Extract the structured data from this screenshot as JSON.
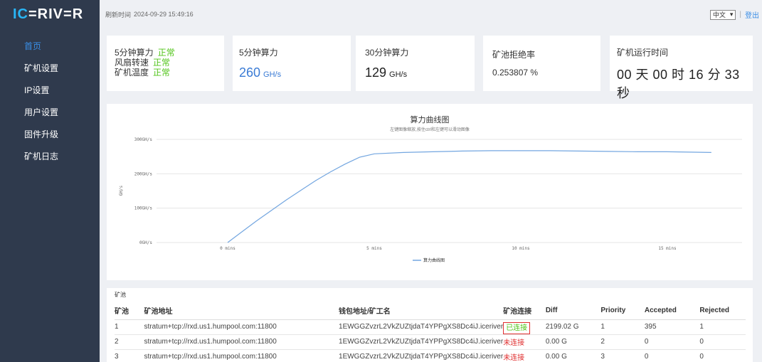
{
  "logo": {
    "part1": "IC",
    "part2": "=RIV=R"
  },
  "sidebar": {
    "items": [
      "首页",
      "矿机设置",
      "IP设置",
      "用户设置",
      "固件升级",
      "矿机日志"
    ]
  },
  "topbar": {
    "refresh_label": "刷新时间",
    "refresh_time": "2024-09-29 15:49:16",
    "language": "中文",
    "logout": "登出"
  },
  "status": {
    "rows": [
      {
        "label": "5分钟算力",
        "value": "正常"
      },
      {
        "label": "风扇转速",
        "value": "正常"
      },
      {
        "label": "矿机温度",
        "value": "正常"
      }
    ]
  },
  "hash5": {
    "title": "5分钟算力",
    "value": "260",
    "unit": "GH/s"
  },
  "hash30": {
    "title": "30分钟算力",
    "value": "129",
    "unit": "GH/s"
  },
  "reject": {
    "title": "矿池拒绝率",
    "value": "0.253807 %"
  },
  "runtime": {
    "title": "矿机运行时间",
    "value": "00 天 00 时 16 分 33 秒"
  },
  "chart_data": {
    "type": "line",
    "title": "算力曲线图",
    "subtitle": "左键图像缩放,按住ctrl和左键可以滑动图像",
    "ylabel": "GH/s",
    "y_ticks": [
      "300GH/s",
      "200GH/s",
      "100GH/s",
      "0GH/s"
    ],
    "x_ticks": [
      "0 mins",
      "5 mins",
      "10 mins",
      "15 mins"
    ],
    "legend": "算力曲线图",
    "ylim": [
      0,
      300
    ],
    "xlim": [
      0,
      16.5
    ],
    "series": [
      {
        "name": "算力曲线图",
        "x": [
          0,
          0.5,
          1,
          1.5,
          2,
          2.5,
          3,
          3.5,
          4,
          4.5,
          5,
          6,
          7,
          8,
          9,
          10,
          11,
          12,
          13,
          14,
          15,
          16.5
        ],
        "values": [
          0,
          32,
          64,
          94,
          124,
          152,
          180,
          205,
          228,
          248,
          258,
          262,
          264,
          266,
          267,
          267,
          267,
          266,
          265,
          264,
          264,
          262
        ]
      }
    ],
    "color": "#73a6e0"
  },
  "pool": {
    "title": "矿池",
    "headers": [
      "矿池",
      "矿池地址",
      "钱包地址/矿工名",
      "矿池连接",
      "Diff",
      "Priority",
      "Accepted",
      "Rejected"
    ],
    "rows": [
      [
        "1",
        "stratum+tcp://rxd.us1.humpool.com:11800",
        "1EWGGZvzrL2VkZUZtjdaT4YPPgXS8Dc4iJ.iceriver",
        "已连接",
        "2199.02 G",
        "1",
        "395",
        "1"
      ],
      [
        "2",
        "stratum+tcp://rxd.us1.humpool.com:11800",
        "1EWGGZvzrL2VkZUZtjdaT4YPPgXS8Dc4iJ.iceriver",
        "未连接",
        "0.00 G",
        "2",
        "0",
        "0"
      ],
      [
        "3",
        "stratum+tcp://rxd.us1.humpool.com:11800",
        "1EWGGZvzrL2VkZUZtjdaT4YPPgXS8Dc4iJ.iceriver",
        "未连接",
        "0.00 G",
        "3",
        "0",
        "0"
      ]
    ]
  },
  "colors": {
    "sidebar": "#2f3a4d",
    "accent": "#3a8ee6",
    "ok": "#52c41a",
    "error": "#e03030"
  }
}
